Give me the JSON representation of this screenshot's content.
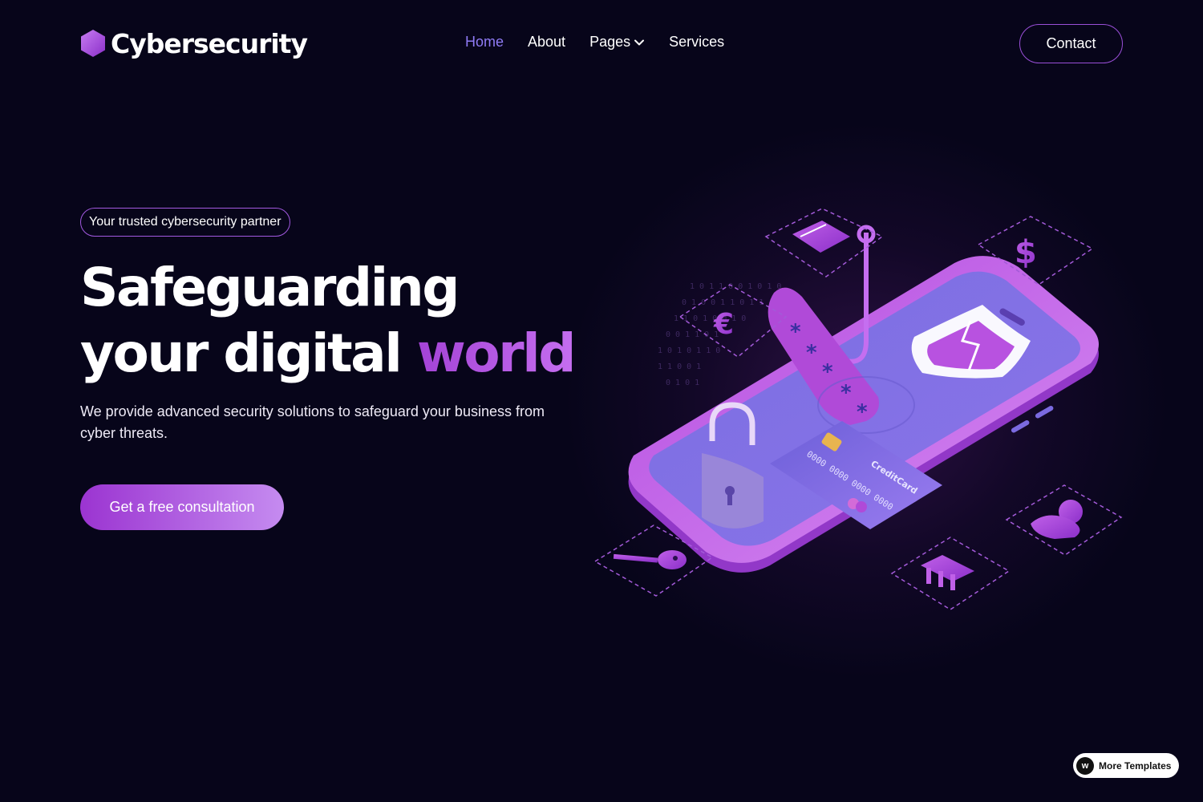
{
  "brand": {
    "name": "Cybersecurity",
    "icon": "hexagon-logo-icon"
  },
  "nav": {
    "items": [
      {
        "label": "Home",
        "active": true
      },
      {
        "label": "About",
        "active": false
      },
      {
        "label": "Pages",
        "active": false,
        "has_dropdown": true
      },
      {
        "label": "Services",
        "active": false
      }
    ],
    "contact_label": "Contact"
  },
  "hero": {
    "badge": "Your trusted cybersecurity partner",
    "headline_line1": "Safeguarding",
    "headline_line2_part1": "your digital",
    "headline_line2_accent": "world",
    "subtitle": "We provide advanced security solutions to safeguard your business from cyber threats.",
    "cta_label": "Get a free consultation"
  },
  "illustration": {
    "card_brand": "CreditCard",
    "card_number": "0000 0000 0000 0000",
    "icons": [
      "credit-card-icon",
      "dollar-icon",
      "euro-icon",
      "key-icon",
      "bank-icon",
      "user-icon",
      "padlock-icon",
      "shield-icon",
      "fishing-hook-icon"
    ]
  },
  "footer_badge": {
    "label": "More Templates",
    "icon": "w"
  },
  "colors": {
    "background": "#07051a",
    "accent": "#a443d6",
    "nav_active": "#8f7bf5"
  }
}
